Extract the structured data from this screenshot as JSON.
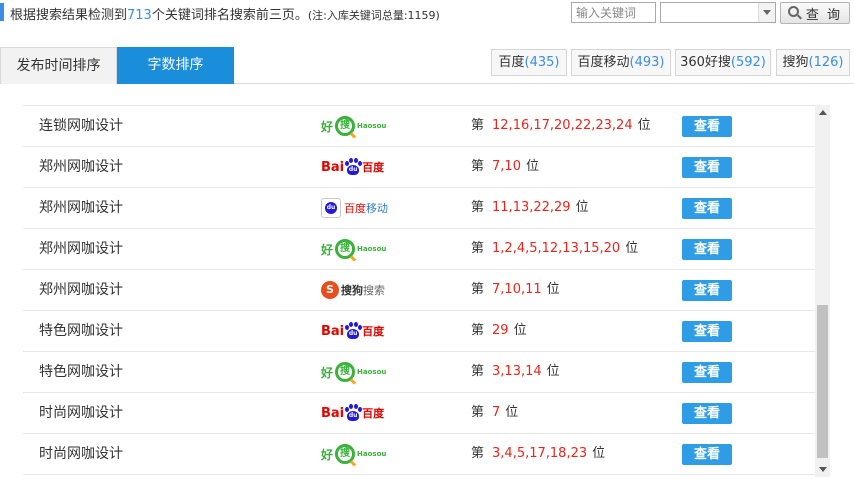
{
  "header": {
    "summary_prefix": "根据搜索结果检测到",
    "keyword_count": "713",
    "summary_suffix": "个关键词排名搜索前三页。",
    "note": "(注:入库关键词总量:1159)",
    "keyword_input_placeholder": "输入关键词",
    "search_button_label": "查 询"
  },
  "tabs": {
    "sort_by_time": "发布时间排序",
    "sort_by_words": "字数排序"
  },
  "engine_tabs": [
    {
      "name": "百度",
      "count": "(435)"
    },
    {
      "name": "百度移动",
      "count": "(493)"
    },
    {
      "name": "360好搜",
      "count": "(592)"
    },
    {
      "name": "搜狗",
      "count": "(126)"
    }
  ],
  "rank_prefix": "第",
  "rank_suffix": "位",
  "view_label": "查看",
  "logos": {
    "haosou_cn1": "好",
    "haosou_cn2": "搜",
    "haosou_en": "Haosou",
    "baidu_en": "Bai",
    "baidu_paw": "du",
    "baidu_cn": "百度",
    "bdm_paw": "du",
    "bdm_cn1": "百度",
    "bdm_cn2": "移动",
    "sogou_mark": "S",
    "sogou_cn1": "搜狗",
    "sogou_cn2": "搜索"
  },
  "rows": [
    {
      "keyword": "连锁网咖设计",
      "engine": "360-haosou",
      "positions": "12,16,17,20,22,23,24"
    },
    {
      "keyword": "郑州网咖设计",
      "engine": "baidu",
      "positions": "7,10"
    },
    {
      "keyword": "郑州网咖设计",
      "engine": "baidu-mobile",
      "positions": "11,13,22,29"
    },
    {
      "keyword": "郑州网咖设计",
      "engine": "360-haosou",
      "positions": "1,2,4,5,12,13,15,20"
    },
    {
      "keyword": "郑州网咖设计",
      "engine": "sogou",
      "positions": "7,10,11"
    },
    {
      "keyword": "特色网咖设计",
      "engine": "baidu",
      "positions": "29"
    },
    {
      "keyword": "特色网咖设计",
      "engine": "360-haosou",
      "positions": "3,13,14"
    },
    {
      "keyword": "时尚网咖设计",
      "engine": "baidu",
      "positions": "7"
    },
    {
      "keyword": "时尚网咖设计",
      "engine": "360-haosou",
      "positions": "3,4,5,17,18,23"
    }
  ],
  "colors": {
    "accent": "#1a8ddb",
    "count_blue": "#3a8ee6",
    "rank_red": "#e8251c",
    "view_button": "#2f9de6"
  }
}
